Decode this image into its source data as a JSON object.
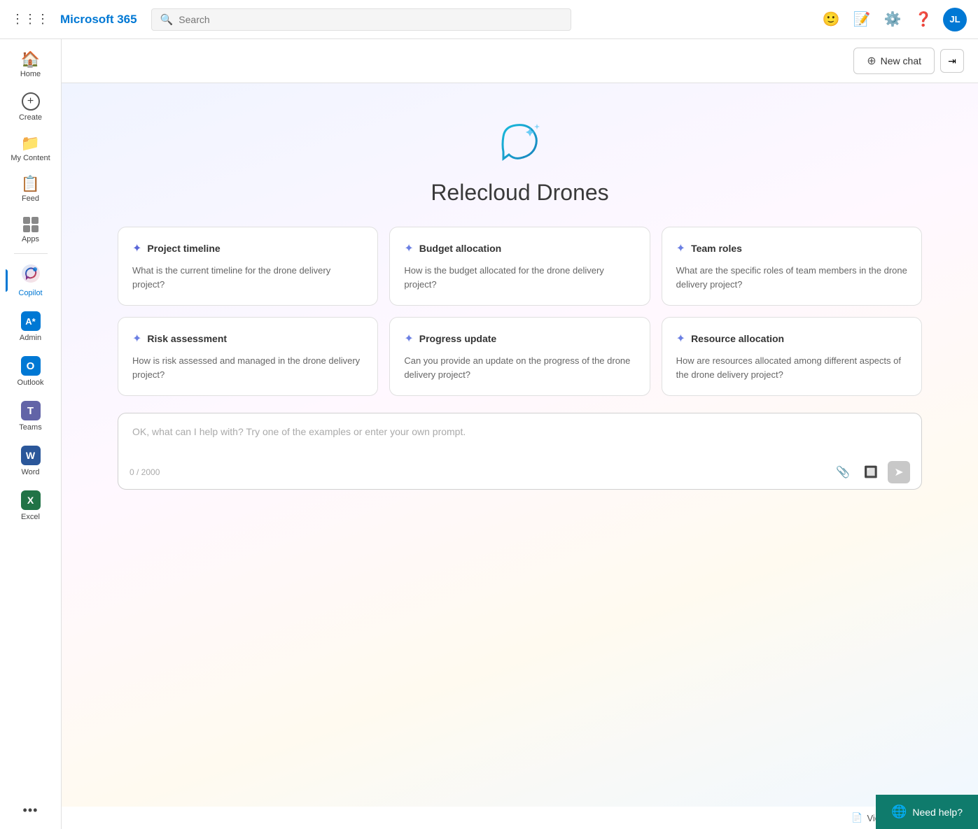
{
  "topbar": {
    "brand": "Microsoft 365",
    "search_placeholder": "Search",
    "avatar_initials": "JL"
  },
  "sidebar": {
    "items": [
      {
        "id": "home",
        "label": "Home",
        "icon": "🏠"
      },
      {
        "id": "create",
        "label": "Create",
        "icon": "➕"
      },
      {
        "id": "my-content",
        "label": "My Content",
        "icon": "📁"
      },
      {
        "id": "feed",
        "label": "Feed",
        "icon": "📋"
      },
      {
        "id": "apps",
        "label": "Apps",
        "icon": "⊞"
      },
      {
        "id": "copilot",
        "label": "Copilot",
        "icon": "◎",
        "active": true
      },
      {
        "id": "admin",
        "label": "Admin",
        "icon": "A*"
      },
      {
        "id": "outlook",
        "label": "Outlook",
        "icon": "O"
      },
      {
        "id": "teams",
        "label": "Teams",
        "icon": "T"
      },
      {
        "id": "word",
        "label": "Word",
        "icon": "W"
      },
      {
        "id": "excel",
        "label": "Excel",
        "icon": "X"
      },
      {
        "id": "more",
        "label": "...",
        "icon": "···"
      }
    ]
  },
  "content_topbar": {
    "new_chat_label": "New chat",
    "toggle_icon": "⇥"
  },
  "copilot": {
    "title": "Relecloud Drones",
    "cards": [
      {
        "id": "project-timeline",
        "title": "Project timeline",
        "body": "What is the current timeline for the drone delivery project?"
      },
      {
        "id": "budget-allocation",
        "title": "Budget allocation",
        "body": "How is the budget allocated for the drone delivery project?"
      },
      {
        "id": "team-roles",
        "title": "Team roles",
        "body": "What are the specific roles of team members in the drone delivery project?"
      },
      {
        "id": "risk-assessment",
        "title": "Risk assessment",
        "body": "How is risk assessed and managed in the drone delivery project?"
      },
      {
        "id": "progress-update",
        "title": "Progress update",
        "body": "Can you provide an update on the progress of the drone delivery project?"
      },
      {
        "id": "resource-allocation",
        "title": "Resource allocation",
        "body": "How are resources allocated among different aspects of the drone delivery project?"
      }
    ],
    "input_placeholder": "OK, what can I help with? Try one of the examples or enter your own prompt.",
    "char_count": "0 / 2000",
    "view_prompts_label": "View prompts"
  },
  "need_help": {
    "label": "Need help?"
  }
}
